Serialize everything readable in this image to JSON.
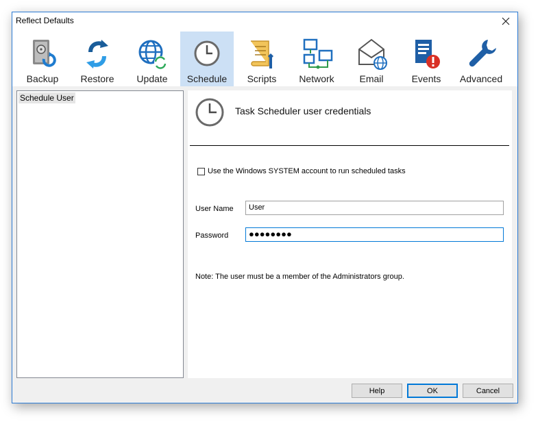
{
  "window": {
    "title": "Reflect Defaults"
  },
  "toolbar": {
    "items": [
      {
        "label": "Backup",
        "icon": "backup-icon"
      },
      {
        "label": "Restore",
        "icon": "restore-icon"
      },
      {
        "label": "Update",
        "icon": "update-icon"
      },
      {
        "label": "Schedule",
        "icon": "schedule-icon",
        "active": true
      },
      {
        "label": "Scripts",
        "icon": "scripts-icon"
      },
      {
        "label": "Network",
        "icon": "network-icon"
      },
      {
        "label": "Email",
        "icon": "email-icon"
      },
      {
        "label": "Events",
        "icon": "events-icon"
      },
      {
        "label": "Advanced",
        "icon": "advanced-icon"
      }
    ]
  },
  "sidebar": {
    "items": [
      {
        "label": "Schedule User",
        "selected": true
      }
    ]
  },
  "panel": {
    "title": "Task Scheduler user credentials",
    "system_checkbox": {
      "label": "Use the Windows SYSTEM account to run scheduled tasks",
      "checked": false
    },
    "username": {
      "label": "User Name",
      "value": "User"
    },
    "password": {
      "label": "Password",
      "value": "●●●●●●●●"
    },
    "note": "Note: The user must be a member of the Administrators group."
  },
  "buttons": {
    "help": "Help",
    "ok": "OK",
    "cancel": "Cancel"
  },
  "colors": {
    "accent": "#0078d7",
    "active_tab_bg": "#cce0f5",
    "window_border": "#2b7bd5"
  }
}
